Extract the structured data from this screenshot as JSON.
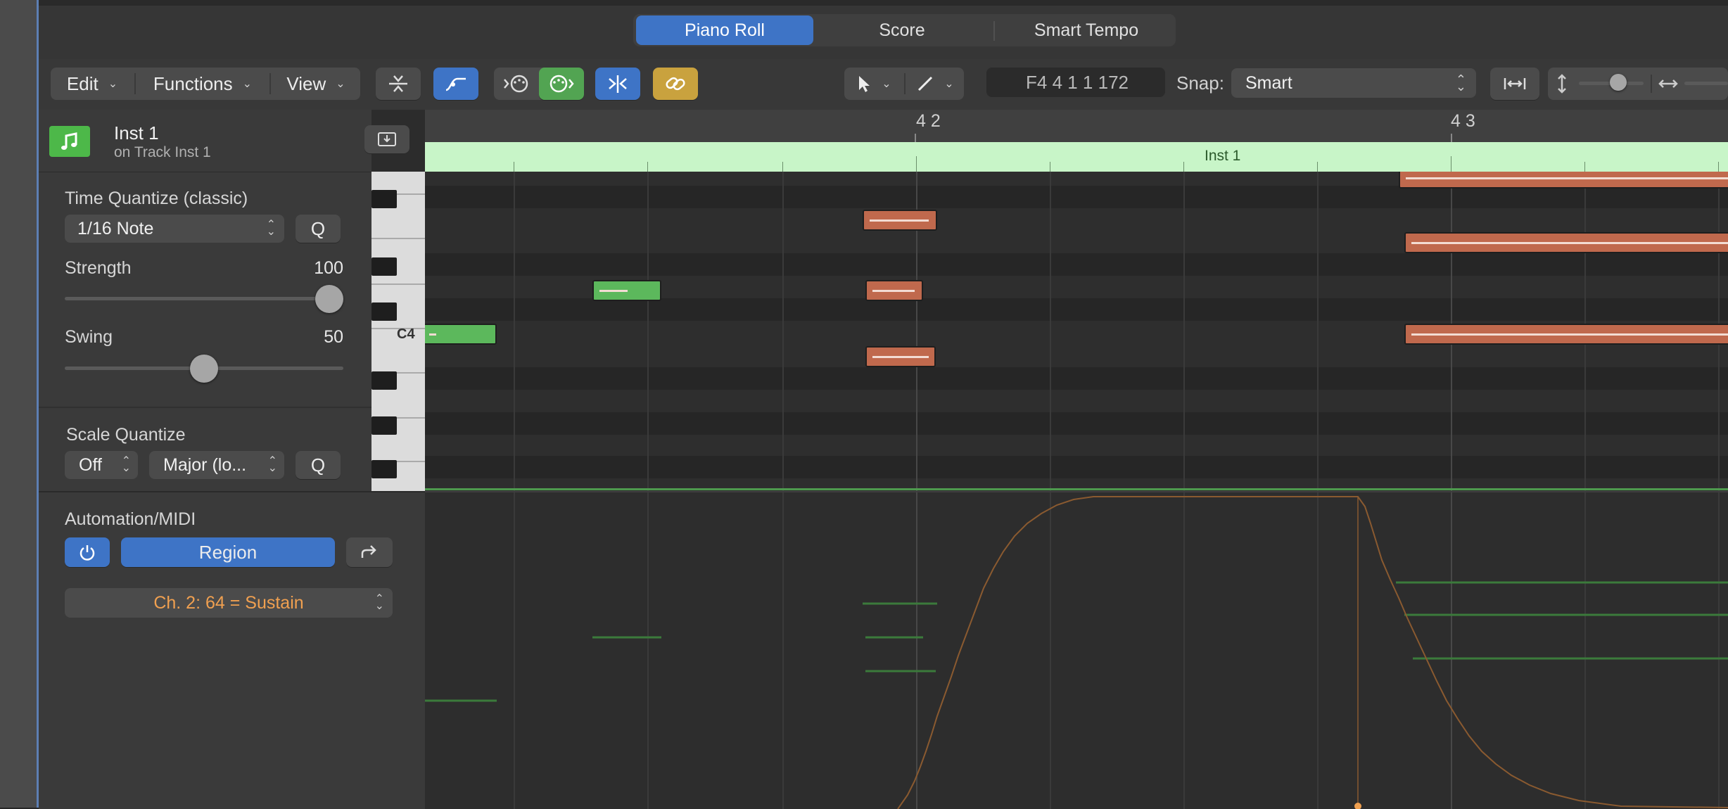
{
  "header": {
    "tabs": [
      {
        "label": "Piano Roll",
        "active": true
      },
      {
        "label": "Score",
        "active": false
      },
      {
        "label": "Smart Tempo",
        "active": false
      }
    ]
  },
  "toolbar": {
    "edit_label": "Edit",
    "functions_label": "Functions",
    "view_label": "View",
    "position_display": "F4   4 1 1 172",
    "snap_label": "Snap:",
    "snap_value": "Smart",
    "icons": [
      "collapse-icon",
      "midi-draw-icon",
      "midi-in-icon",
      "midi-out-icon",
      "catch-icon",
      "link-icon",
      "pointer-tool-icon",
      "pencil-tool-icon",
      "fit-icon",
      "vertical-zoom-icon",
      "horizontal-zoom-icon"
    ]
  },
  "track": {
    "name": "Inst 1",
    "subtitle": "on Track Inst 1",
    "icon": "music-note-icon"
  },
  "inspector": {
    "time_quantize_label": "Time Quantize (classic)",
    "time_quantize_value": "1/16 Note",
    "q_label": "Q",
    "strength_label": "Strength",
    "strength_value": "100",
    "strength_level": 1.0,
    "swing_label": "Swing",
    "swing_value": "50",
    "swing_level": 0.5,
    "scale_quantize_label": "Scale Quantize",
    "scale_root_value": "Off",
    "scale_type_value": "Major (lo...",
    "scale_q_label": "Q"
  },
  "automation": {
    "section_label": "Automation/MIDI",
    "region_label": "Region",
    "controller_value": "Ch. 2: 64 = Sustain",
    "accent_color": "#f0a050"
  },
  "ruler": {
    "bar_labels": [
      "4 2",
      "4 3"
    ]
  },
  "region": {
    "name": "Inst 1",
    "color": "#c8f5c8"
  },
  "keyboard": {
    "c4_label": "C4"
  },
  "colors": {
    "accent": "#3e74c6",
    "selected_note": "#c0694d",
    "unselected_note": "#5cb85c",
    "link_button": "#c9a23e"
  }
}
